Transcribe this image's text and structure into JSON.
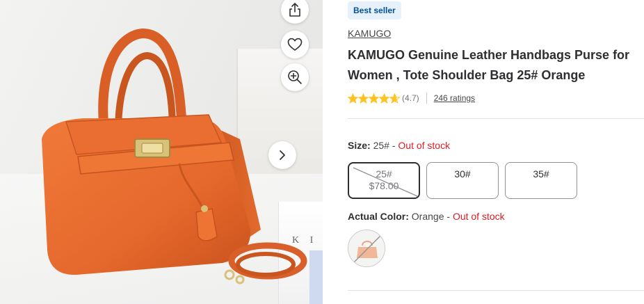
{
  "product": {
    "badge": "Best seller",
    "brand": "KAMUGO",
    "title": "KAMUGO Genuine Leather Handbags Purse for Women , Tote Shoulder Bag 25# Orange",
    "rating": 4.7,
    "rating_display": "(4.7)",
    "ratings_count": "246 ratings"
  },
  "image_controls": {
    "share": "share-icon",
    "favorite": "heart-icon",
    "zoom": "zoom-in-icon",
    "next": "chevron-right-icon"
  },
  "image_text": {
    "box_letters": "K I"
  },
  "size": {
    "label": "Size:",
    "selected": "25#",
    "separator": " - ",
    "status": "Out of stock",
    "options": [
      {
        "label": "25#",
        "price": "$78.00",
        "selected": true,
        "unavailable": true
      },
      {
        "label": "30#",
        "price": "",
        "selected": false,
        "unavailable": false
      },
      {
        "label": "35#",
        "price": "",
        "selected": false,
        "unavailable": false
      }
    ]
  },
  "color": {
    "label": "Actual Color:",
    "selected": "Orange",
    "separator": " - ",
    "status": "Out of stock"
  },
  "colors": {
    "accent_blue": "#004f9a",
    "badge_bg": "#e6f1fc",
    "out_of_stock": "#de1c24",
    "star": "#ffc220",
    "bag_orange": "#e86a2e"
  }
}
